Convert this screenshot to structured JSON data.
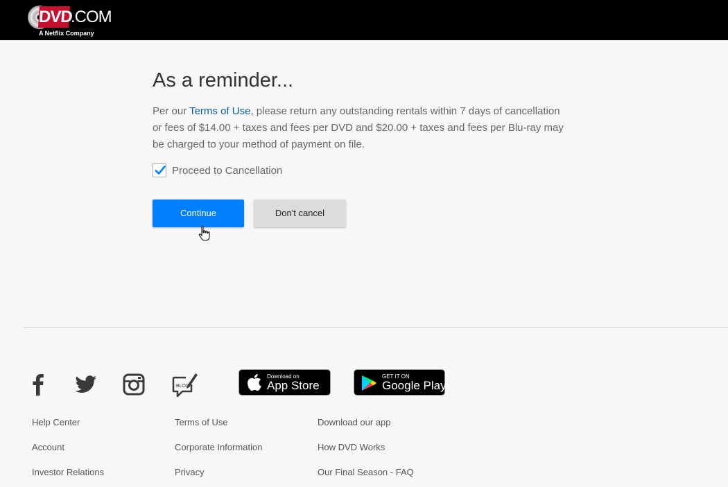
{
  "header": {
    "logo_text_red": "DVD",
    "logo_text_white": ".COM",
    "logo_tagline": "A Netflix Company"
  },
  "main": {
    "title": "As a reminder...",
    "desc_prefix": "Per our ",
    "desc_link": "Terms of Use",
    "desc_suffix": ", please return any outstanding rentals within 7 days of cancellation or fees of $14.00 + taxes and fees per DVD and $20.00 + taxes and fees per Blu-ray may be charged to your method of payment on file.",
    "checkbox_label": "Proceed to Cancellation",
    "checkbox_checked": true,
    "continue_label": "Continue",
    "cancel_label": "Don't cancel"
  },
  "footer": {
    "social": [
      "facebook-icon",
      "twitter-icon",
      "instagram-icon",
      "blog-icon"
    ],
    "blog_text": "BLOG",
    "app_store": {
      "small": "Download on",
      "big": "App Store"
    },
    "google_play": {
      "small": "GET IT ON",
      "big": "Google Play"
    },
    "links_col1": [
      "Help Center",
      "Account",
      "Investor Relations"
    ],
    "links_col2": [
      "Terms of Use",
      "Corporate Information",
      "Privacy"
    ],
    "links_col3": [
      "Download our app",
      "How DVD Works",
      "Our Final Season - FAQ"
    ]
  },
  "colors": {
    "header_bg": "#000000",
    "accent": "#0080ff",
    "link": "#0c5fa6",
    "logo_red": "#c8102e"
  }
}
